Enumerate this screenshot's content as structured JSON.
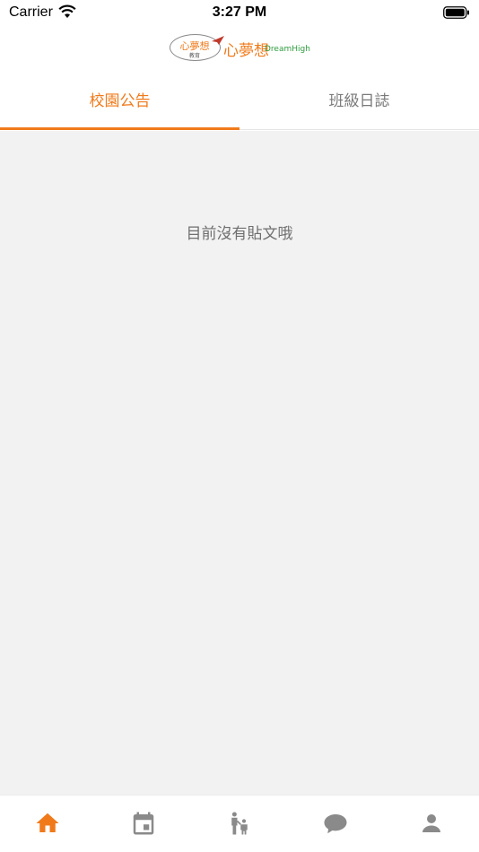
{
  "status_bar": {
    "carrier": "Carrier",
    "time": "3:27 PM"
  },
  "logo": {
    "badge_text": "心夢想",
    "badge_sub": "教育",
    "main_text": "心夢想",
    "dream_text": "DreamHigh"
  },
  "tabs": [
    {
      "label": "校園公告",
      "active": true
    },
    {
      "label": "班級日誌",
      "active": false
    }
  ],
  "content": {
    "empty_message": "目前沒有貼文哦"
  },
  "bottom_nav": [
    {
      "icon": "home-icon",
      "active": true
    },
    {
      "icon": "calendar-icon",
      "active": false
    },
    {
      "icon": "family-icon",
      "active": false
    },
    {
      "icon": "chat-icon",
      "active": false
    },
    {
      "icon": "profile-icon",
      "active": false
    }
  ],
  "colors": {
    "accent": "#f07a1a",
    "inactive_icon": "#8a8a8a",
    "content_bg": "#f2f2f2"
  }
}
